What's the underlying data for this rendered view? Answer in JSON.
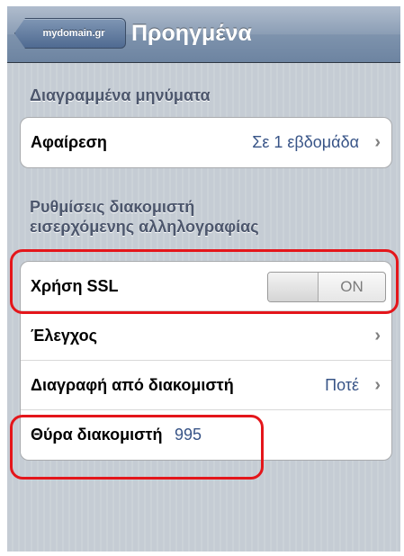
{
  "nav": {
    "back_label": "mydomain.gr",
    "title": "Προηγμένα"
  },
  "deleted_section": {
    "header": "Διαγραμμένα μηνύματα",
    "remove_label": "Αφαίρεση",
    "remove_value": "Σε 1 εβδομάδα"
  },
  "incoming_section": {
    "header_line1": "Ρυθμίσεις διακομιστή",
    "header_line2": "εισερχόμενης αλληλογραφίας",
    "use_ssl_label": "Χρήση SSL",
    "use_ssl_state": "ON",
    "auth_label": "Έλεγχος",
    "delete_from_server_label": "Διαγραφή από διακομιστή",
    "delete_from_server_value": "Ποτέ",
    "server_port_label": "Θύρα διακομιστή",
    "server_port_value": "995"
  },
  "icons": {
    "chevron": "chevron-right-icon"
  },
  "colors": {
    "value_text": "#385487",
    "highlight": "#e4161b",
    "navbar": "#6d84a1"
  }
}
